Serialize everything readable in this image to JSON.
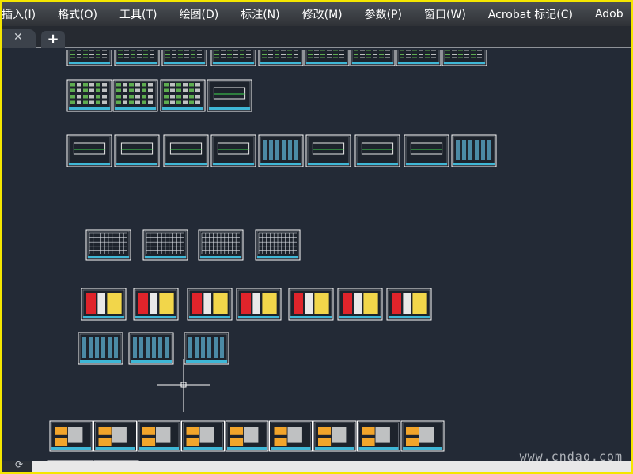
{
  "menubar": {
    "items": [
      "插入(I)",
      "格式(O)",
      "工具(T)",
      "绘图(D)",
      "标注(N)",
      "修改(M)",
      "参数(P)",
      "窗口(W)",
      "Acrobat 标记(C)",
      "Adob"
    ]
  },
  "tabs": {
    "close_icon": "close-icon",
    "new_tab_icon": "plus-icon"
  },
  "watermark": "www.cndao.com",
  "colors": {
    "canvas_bg": "#232a36",
    "sheet_border": "#ffffff",
    "title_block": "#3fb7d6",
    "red": "#e0242b",
    "yellow": "#f2d64a",
    "orange": "#f2a52b",
    "green": "#39b54a",
    "crosshair": "#ffffff"
  }
}
